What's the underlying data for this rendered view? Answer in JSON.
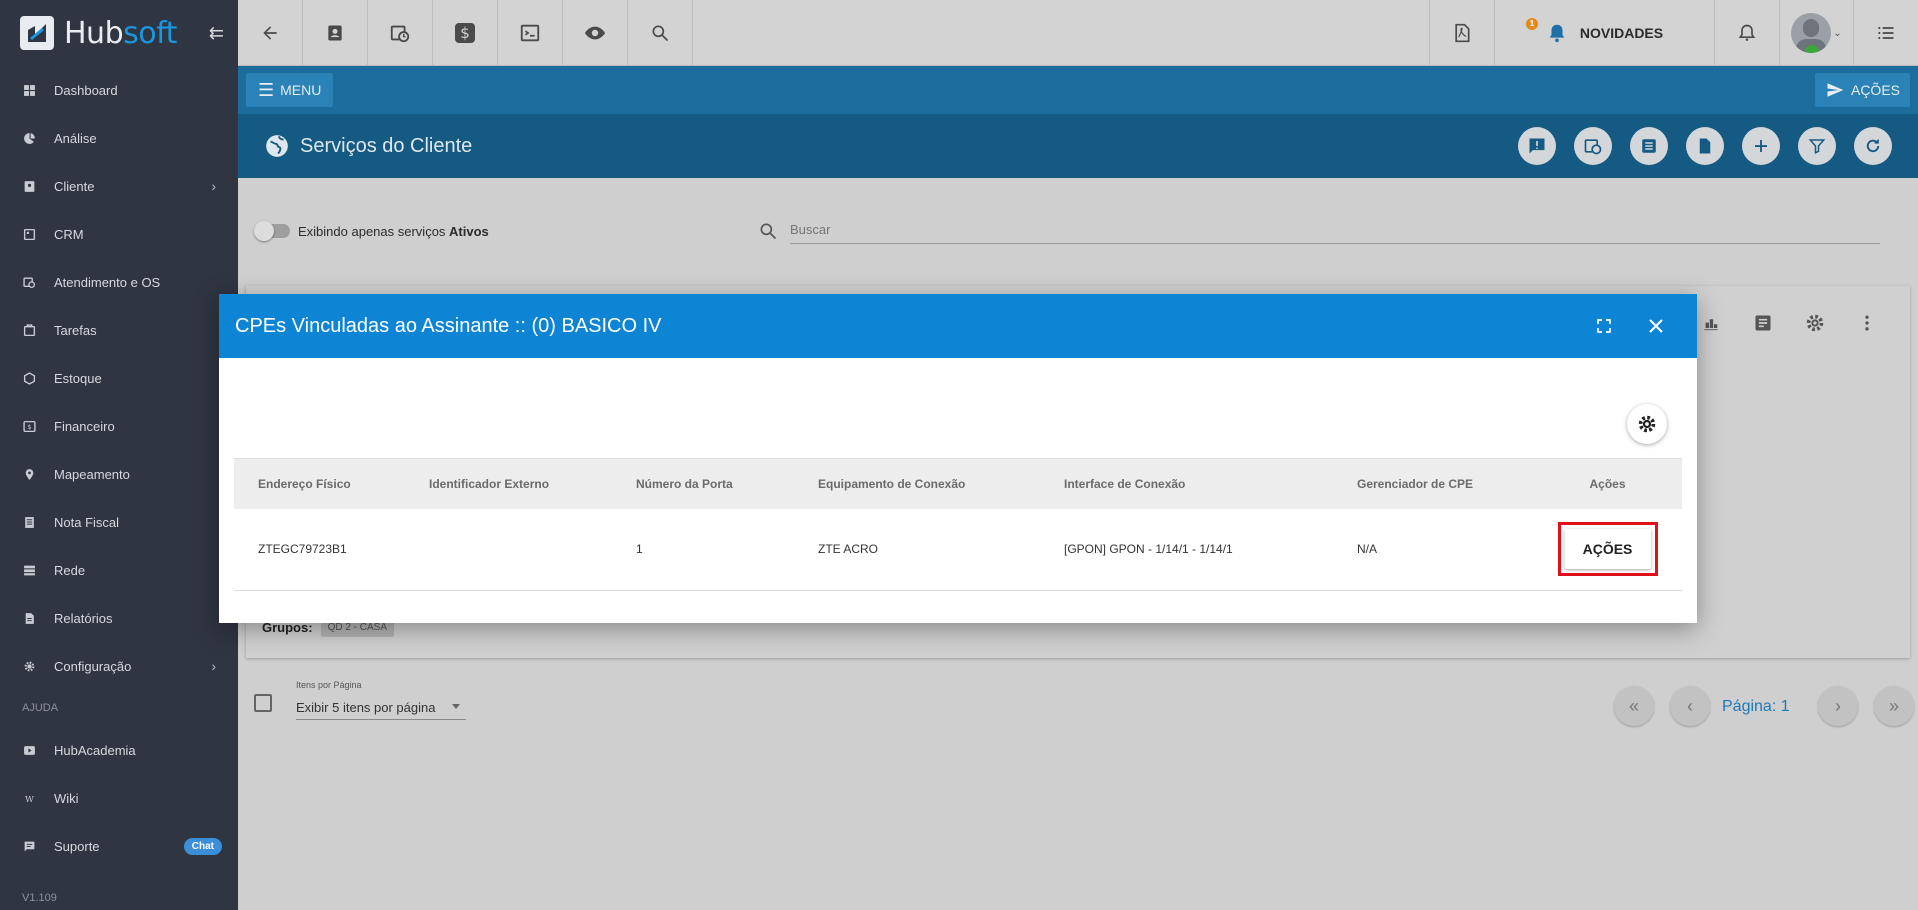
{
  "app": {
    "brand_a": "Hub",
    "brand_b": "soft",
    "version": "V1.109"
  },
  "sidebar": {
    "items": [
      {
        "label": "Dashboard",
        "icon": "dashboard-icon"
      },
      {
        "label": "Análise",
        "icon": "chart-pie-icon"
      },
      {
        "label": "Cliente",
        "icon": "contact-icon",
        "submenu": true
      },
      {
        "label": "CRM",
        "icon": "crm-icon"
      },
      {
        "label": "Atendimento e OS",
        "icon": "calendar-clock-icon"
      },
      {
        "label": "Tarefas",
        "icon": "tasks-icon"
      },
      {
        "label": "Estoque",
        "icon": "box-icon"
      },
      {
        "label": "Financeiro",
        "icon": "dollar-icon"
      },
      {
        "label": "Mapeamento",
        "icon": "map-pin-icon"
      },
      {
        "label": "Nota Fiscal",
        "icon": "receipt-icon"
      },
      {
        "label": "Rede",
        "icon": "network-icon"
      },
      {
        "label": "Relatórios",
        "icon": "report-icon"
      },
      {
        "label": "Configuração",
        "icon": "gear-icon",
        "submenu": true
      }
    ],
    "section_help": "AJUDA",
    "help_items": [
      {
        "label": "HubAcademia",
        "icon": "play-icon"
      },
      {
        "label": "Wiki",
        "icon": "wiki-icon"
      },
      {
        "label": "Suporte",
        "icon": "chat-icon",
        "badge": "Chat"
      }
    ]
  },
  "topbar": {
    "novidades": "NOVIDADES",
    "notif_count": "1"
  },
  "menubar": {
    "menu_label": "MENU",
    "acoes_label": "AÇÕES"
  },
  "page": {
    "title": "Serviços do Cliente"
  },
  "filters": {
    "toggle_label_prefix": "Exibindo apenas serviços ",
    "toggle_label_strong": "Ativos",
    "search_placeholder": "Buscar"
  },
  "card": {
    "groups_label": "Grupos:",
    "group_chip": "QD 2 - CASA"
  },
  "pagination": {
    "items_per_page_label": "Itens por Página",
    "items_per_page_value": "Exibir 5 itens por página",
    "page_label": "Página: 1"
  },
  "modal": {
    "title": "CPEs Vinculadas ao Assinante :: (0) BASICO IV",
    "columns": [
      "Endereço Físico",
      "Identificador Externo",
      "Número da Porta",
      "Equipamento de Conexão",
      "Interface de Conexão",
      "Gerenciador de CPE",
      "Ações"
    ],
    "rows": [
      {
        "endereco_fisico": "ZTEGC79723B1",
        "identificador_externo": "",
        "numero_porta": "1",
        "equipamento": "ZTE ACRO",
        "interface": "[GPON] GPON - 1/14/1 - 1/14/1",
        "gerenciador": "N/A",
        "acoes_label": "AÇÕES"
      }
    ]
  },
  "colors": {
    "modal_header": "#0d84d4",
    "highlight": "#e0101a",
    "sidebar_bg": "#2f3541"
  }
}
